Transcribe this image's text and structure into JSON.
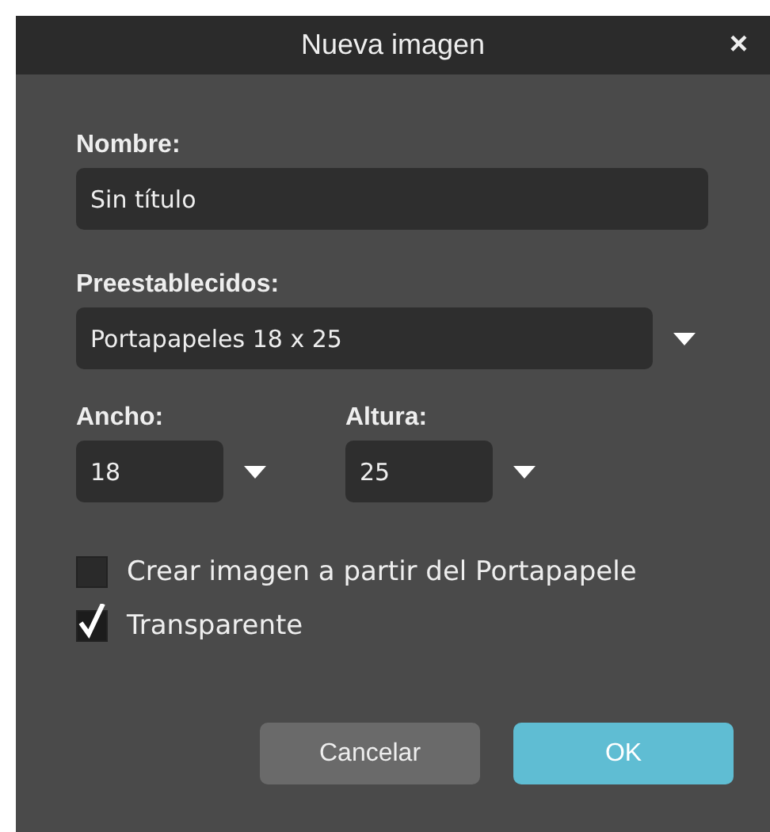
{
  "window": {
    "title": "Nueva imagen",
    "close": "×"
  },
  "name": {
    "label": "Nombre:",
    "value": "Sin título"
  },
  "preset": {
    "label": "Preestablecidos:",
    "value": "Portapapeles 18 x 25"
  },
  "size": [
    {
      "label": "Ancho:",
      "value": "18"
    },
    {
      "label": "Altura:",
      "value": "25"
    }
  ],
  "options": [
    {
      "label": "Crear imagen a partir del Portapapele",
      "checked": false
    },
    {
      "label": "Transparente",
      "checked": true
    }
  ],
  "buttons": [
    {
      "label": "Cancelar",
      "kind": "secondary"
    },
    {
      "label": "OK",
      "kind": "primary"
    }
  ]
}
